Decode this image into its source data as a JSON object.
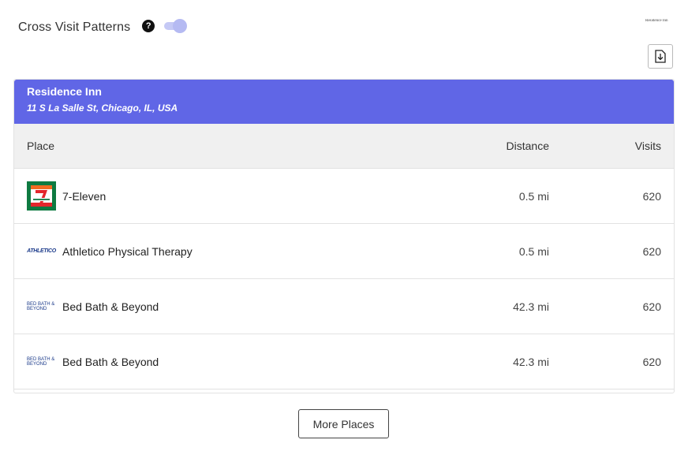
{
  "header": {
    "title": "Cross Visit Patterns",
    "help_glyph": "?",
    "toggle_on": true
  },
  "brand_logo_text": "Residence Inn",
  "selected_place": {
    "name": "Residence Inn",
    "address": "11 S La Salle St, Chicago, IL, USA"
  },
  "table": {
    "columns": {
      "place": "Place",
      "distance": "Distance",
      "visits": "Visits"
    },
    "rows": [
      {
        "name": "7-Eleven",
        "distance": "0.5 mi",
        "visits": "620",
        "logo": "seven-eleven-logo"
      },
      {
        "name": "Athletico Physical Therapy",
        "distance": "0.5 mi",
        "visits": "620",
        "logo": "athletico-logo",
        "logo_text": "ATHLETICO"
      },
      {
        "name": "Bed Bath & Beyond",
        "distance": "42.3 mi",
        "visits": "620",
        "logo": "bed-bath-beyond-logo",
        "logo_text": "BED BATH & BEYOND"
      },
      {
        "name": "Bed Bath & Beyond",
        "distance": "42.3 mi",
        "visits": "620",
        "logo": "bed-bath-beyond-logo",
        "logo_text": "BED BATH & BEYOND"
      }
    ]
  },
  "more_button_label": "More Places",
  "colors": {
    "accent": "#6066e6",
    "toggle_track": "#c5c9f5",
    "toggle_thumb": "#b5baf2",
    "seven_eleven_green": "#0e7a41",
    "seven_eleven_orange": "#f26b21",
    "seven_eleven_red": "#e4262c"
  },
  "icons": {
    "help": "help-icon",
    "download": "download-icon"
  }
}
